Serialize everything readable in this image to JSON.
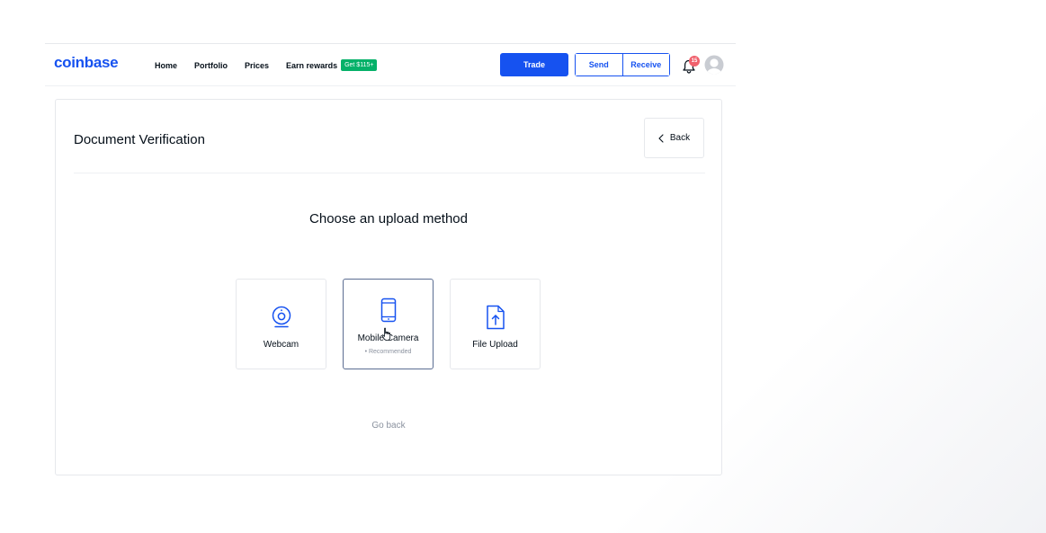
{
  "navbar": {
    "logo": "coinbase",
    "links": {
      "home": "Home",
      "portfolio": "Portfolio",
      "prices": "Prices",
      "earn_rewards": "Earn rewards"
    },
    "earn_badge": "Get $115+",
    "trade_label": "Trade",
    "send_label": "Send",
    "receive_label": "Receive",
    "notification_count": "15"
  },
  "card": {
    "title": "Document Verification",
    "back_label": "Back",
    "heading": "Choose an upload method",
    "options": {
      "webcam": {
        "label": "Webcam"
      },
      "mobile_camera": {
        "label": "Mobile Camera",
        "sub": "• Recommended"
      },
      "file_upload": {
        "label": "File Upload"
      }
    },
    "go_back": "Go back"
  },
  "colors": {
    "brand_blue": "#1652f0",
    "badge_green": "#05b169",
    "notification_red": "#f0616d",
    "muted_text": "#8a919e"
  },
  "icons": {
    "webcam": "webcam-icon",
    "mobile": "mobile-phone-icon",
    "file_upload": "file-upload-icon",
    "back": "chevron-left-icon",
    "bell": "bell-icon",
    "avatar": "user-avatar-icon",
    "cursor": "hand-cursor-icon"
  }
}
